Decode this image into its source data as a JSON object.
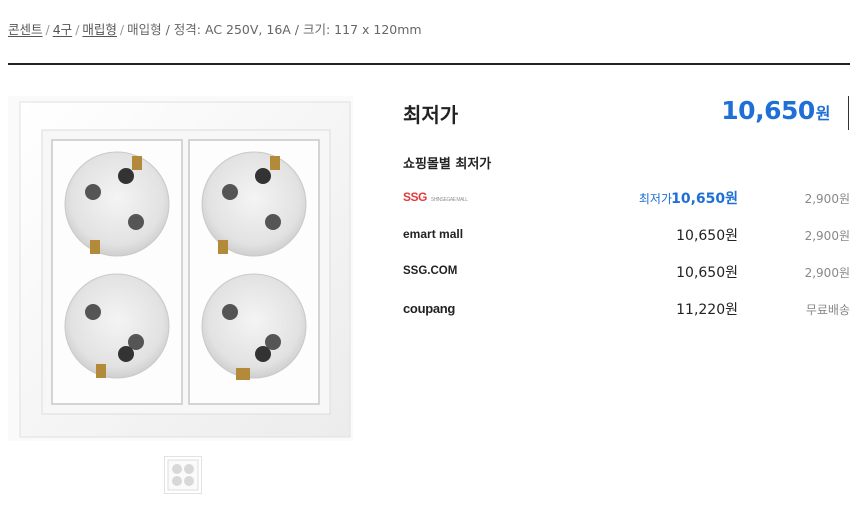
{
  "breadcrumb": {
    "items": [
      "콘센트",
      "4구",
      "매립형"
    ],
    "specs": "매입형 / 정격: AC 250V, 16A / 크기: 117 x 120mm"
  },
  "product": {
    "image_alt": "4구 매입형 콘센트"
  },
  "price": {
    "lowest_label": "최저가",
    "lowest_value": "10,650",
    "currency": "원"
  },
  "malls": {
    "title": "쇼핑몰별 최저가",
    "rows": [
      {
        "logo": "SSG",
        "logo_sub": "SHINSEGAE MALL",
        "tag": "최저가",
        "price": "10,650원",
        "shipping": "2,900원"
      },
      {
        "logo": "emart mall",
        "tag": "",
        "price": "10,650원",
        "shipping": "2,900원"
      },
      {
        "logo": "SSG.COM",
        "tag": "",
        "price": "10,650원",
        "shipping": "2,900원"
      },
      {
        "logo": "coupang",
        "tag": "",
        "price": "11,220원",
        "shipping": "무료배송"
      }
    ]
  },
  "colors": {
    "accent": "#1f6fd6",
    "divider": "#222222",
    "ssg_red": "#e23a3a",
    "emart_yellow": "#f7a600"
  }
}
